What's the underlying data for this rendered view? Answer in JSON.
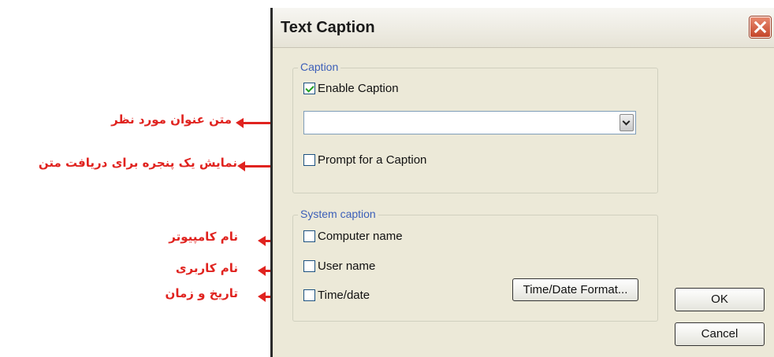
{
  "dialog": {
    "title": "Text Caption",
    "ok_label": "OK",
    "cancel_label": "Cancel"
  },
  "caption_group": {
    "label": "Caption",
    "enable_caption": {
      "label": "Enable Caption",
      "checked": true
    },
    "caption_value": "",
    "prompt_caption": {
      "label": "Prompt for a Caption",
      "checked": false
    }
  },
  "system_group": {
    "label": "System caption",
    "computer_name": {
      "label": "Computer name",
      "checked": false
    },
    "user_name": {
      "label": "User name",
      "checked": false
    },
    "time_date": {
      "label": "Time/date",
      "checked": false
    },
    "format_button": "Time/Date Format..."
  },
  "annotations": {
    "caption_text": "متن عنوان مورد نظر",
    "prompt_window": "نمایش یک پنجره برای دریافت متن",
    "computer_name": "نام کامپیوتر",
    "user_name": "نام کاربری",
    "date_time": "تاریخ و زمان"
  },
  "colors": {
    "annotation": "#e0231f",
    "dialog_bg": "#ece9d8",
    "group_label": "#3c5fb8"
  }
}
